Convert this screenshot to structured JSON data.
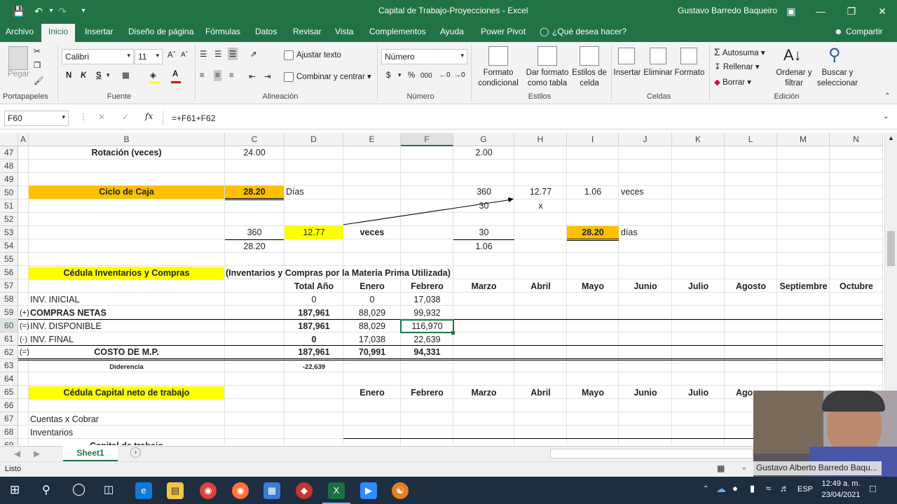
{
  "window": {
    "title": "Capital de Trabajo-Proyecciones  -  Excel",
    "user": "Gustavo  Barredo Baqueiro"
  },
  "ribbon_tabs": [
    "Archivo",
    "Inicio",
    "Insertar",
    "Diseño de página",
    "Fórmulas",
    "Datos",
    "Revisar",
    "Vista",
    "Complementos",
    "Ayuda",
    "Power Pivot"
  ],
  "tell_me": "¿Qué desea hacer?",
  "share": "Compartir",
  "ribbon": {
    "paste": "Pegar",
    "clipboard": "Portapapeles",
    "font_name": "Calibri",
    "font_size": "11",
    "font_group": "Fuente",
    "bold": "N",
    "italic": "K",
    "underline": "S",
    "wrap": "Ajustar texto",
    "merge": "Combinar y centrar",
    "align_group": "Alineación",
    "num_format": "Número",
    "currency": "$",
    "percent": "%",
    "thousands": "000",
    "num_group": "Número",
    "cond_format_1": "Formato",
    "cond_format_2": "condicional",
    "table_format_1": "Dar formato",
    "table_format_2": "como tabla",
    "cell_styles_1": "Estilos de",
    "cell_styles_2": "celda",
    "styles_group": "Estilos",
    "insert": "Insertar",
    "delete": "Eliminar",
    "format": "Formato",
    "cells_group": "Celdas",
    "autosum": "Autosuma",
    "fill": "Rellenar",
    "clear": "Borrar",
    "sort_1": "Ordenar y",
    "sort_2": "filtrar",
    "find_1": "Buscar y",
    "find_2": "seleccionar",
    "edit_group": "Edición"
  },
  "formula_bar": {
    "name_box": "F60",
    "formula": "=+F61+F62",
    "fx": "fx"
  },
  "columns": [
    "A",
    "B",
    "C",
    "D",
    "E",
    "F",
    "G",
    "H",
    "I",
    "J",
    "K",
    "L",
    "M",
    "N"
  ],
  "rows": [
    "47",
    "48",
    "49",
    "50",
    "51",
    "52",
    "53",
    "54",
    "55",
    "56",
    "57",
    "58",
    "59",
    "60",
    "61",
    "62",
    "63",
    "64",
    "65",
    "66",
    "67",
    "68",
    "69"
  ],
  "cells": {
    "r47b": "Rotación (veces)",
    "r47c": "24.00",
    "r47g": "2.00",
    "r50b": "Ciclo de Caja",
    "r50c": "28.20",
    "r50d": "Días",
    "r50g": "360",
    "r50h": "12.77",
    "r50i": "1.06",
    "r50j": "veces",
    "r51g": "30",
    "r51h": "x",
    "r53c": "360",
    "r53d": "12.77",
    "r53e": "veces",
    "r53g": "30",
    "r53i": "28.20",
    "r53j": "días",
    "r54c": "28.20",
    "r54g": "1.06",
    "r56b": "Cédula Inventarios y Compras",
    "r56c": "(Inventarios y Compras por la Materia Prima Utilizada)",
    "r57d": "Total Año",
    "r57e": "Enero",
    "r57f": "Febrero",
    "r57g": "Marzo",
    "r57h": "Abril",
    "r57i": "Mayo",
    "r57j": "Junio",
    "r57k": "Julio",
    "r57l": "Agosto",
    "r57m": "Septiembre",
    "r57n": "Octubre",
    "r58b": "INV. INICIAL",
    "r58d": "0",
    "r58e": "0",
    "r58f": "17,038",
    "r59a": "(+)",
    "r59b": "COMPRAS NETAS",
    "r59d": "187,961",
    "r59e": "88,029",
    "r59f": "99,932",
    "r60a": "(=)",
    "r60b": "INV. DISPONIBLE",
    "r60d": "187,961",
    "r60e": "88,029",
    "r60f": "116,970",
    "r61a": "(-)",
    "r61b": "INV. FINAL",
    "r61d": "0",
    "r61e": "17,038",
    "r61f": "22,639",
    "r62a": "(=)",
    "r62b": "COSTO DE M.P.",
    "r62d": "187,961",
    "r62e": "70,991",
    "r62f": "94,331",
    "r63b": "Diderencia",
    "r63d": "-22,639",
    "r65b": "Cédula Capital neto de trabajo",
    "r65e": "Enero",
    "r65f": "Febrero",
    "r65g": "Marzo",
    "r65h": "Abril",
    "r65i": "Mayo",
    "r65j": "Junio",
    "r65k": "Julio",
    "r65l": "Agos",
    "r67b": "Cuentas x Cobrar",
    "r68b": "Inventarios",
    "r69b": "Capital de trabajo"
  },
  "sheet_tab": "Sheet1",
  "status": "Listo",
  "webcam_label": "Gustavo Alberto Barredo Baqu...",
  "taskbar": {
    "lang": "ESP",
    "time": "12:49 a. m.",
    "date": "23/04/2021"
  },
  "colors": {
    "excel_green": "#217346",
    "orange": "#ffc000",
    "yellow": "#ffff00"
  }
}
